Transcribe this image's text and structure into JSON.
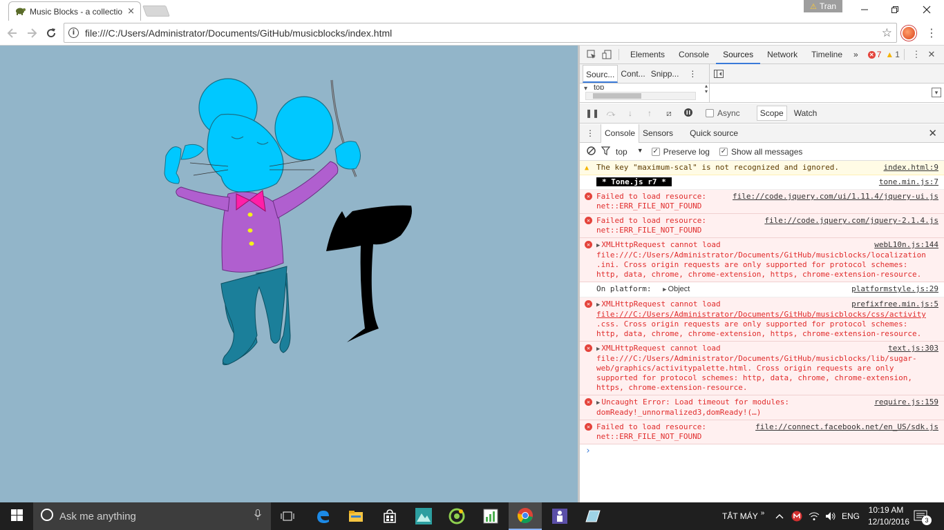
{
  "browser": {
    "tab_title": "Music Blocks - a collectio",
    "tab_close": "×",
    "user_name": "Tran",
    "url": "file:///C:/Users/Administrator/Documents/GitHub/musicblocks/index.html"
  },
  "devtools": {
    "main_tabs": [
      "Elements",
      "Console",
      "Sources",
      "Network",
      "Timeline"
    ],
    "active_tab": "Sources",
    "more_tabs": "»",
    "error_count": "7",
    "warning_count": "1",
    "sources_subtabs": [
      "Sourc...",
      "Cont...",
      "Snipp..."
    ],
    "nav_item": "top",
    "async_label": "Async",
    "scope_label": "Scope",
    "watch_label": "Watch",
    "drawer_tabs": [
      "Console",
      "Sensors",
      "Quick source"
    ],
    "context": "top",
    "preserve_log": "Preserve log",
    "show_all": "Show all messages"
  },
  "console": {
    "messages": [
      {
        "type": "warn",
        "text": "The key \"maximum-scal\" is not recognized and ignored.",
        "source": "index.html:9"
      },
      {
        "type": "log",
        "badge": "* Tone.js r7 *",
        "source": "tone.min.js:7"
      },
      {
        "type": "error",
        "line1": "Failed to load resource:",
        "line2": "net::ERR_FILE_NOT_FOUND",
        "source": "file://code.jquery.com/ui/1.11.4/jquery-ui.js"
      },
      {
        "type": "error",
        "line1": "Failed to load resource:",
        "line2": "net::ERR_FILE_NOT_FOUND",
        "source": "file://code.jquery.com/jquery-2.1.4.js"
      },
      {
        "type": "error",
        "expand": true,
        "line1": "XMLHttpRequest cannot load",
        "line2": "file:///C:/Users/Administrator/Documents/GitHub/musicblocks/localization",
        "line3": ".ini. Cross origin requests are only supported for protocol schemes:",
        "line4": "http, data, chrome, chrome-extension, https, chrome-extension-resource.",
        "source": "webL10n.js:144"
      },
      {
        "type": "log",
        "text": "On platform:",
        "object": "Object",
        "source": "platformstyle.js:29"
      },
      {
        "type": "error",
        "expand": true,
        "line1": "XMLHttpRequest cannot load",
        "line2": "file:///C:/Users/Administrator/Documents/GitHub/musicblocks/css/activity",
        "line3": ".css. Cross origin requests are only supported for protocol schemes:",
        "line4": "http, data, chrome, chrome-extension, https, chrome-extension-resource.",
        "source": "prefixfree.min.js:5"
      },
      {
        "type": "error",
        "expand": true,
        "line1": "XMLHttpRequest cannot load",
        "line2": "file:///C:/Users/Administrator/Documents/GitHub/musicblocks/lib/sugar-",
        "line3": "web/graphics/activitypalette.html. Cross origin requests are only",
        "line4": "supported for protocol schemes: http, data, chrome, chrome-extension,",
        "line5": "https, chrome-extension-resource.",
        "source": "text.js:303"
      },
      {
        "type": "error",
        "expand": true,
        "line1": "Uncaught Error: Load timeout for modules:",
        "line2": "domReady!_unnormalized3,domReady!(…)",
        "source": "require.js:159"
      },
      {
        "type": "error",
        "line1": "Failed to load resource:",
        "line2": "net::ERR_FILE_NOT_FOUND",
        "source": "file://connect.facebook.net/en_US/sdk.js"
      }
    ],
    "prompt": "›"
  },
  "taskbar": {
    "search_placeholder": "Ask me anything",
    "tray_label": "TẮT MÁY",
    "language": "ENG",
    "time": "10:19 AM",
    "date": "12/10/2016",
    "notification_count": "3"
  },
  "colors": {
    "page_bg": "#92b5c9",
    "mouse_blue": "#00c8ff",
    "shirt_purple": "#b05fcf",
    "pants_teal": "#1b7f9a",
    "bowtie": "#ff1fa8",
    "error_text": "#e02c2c"
  }
}
